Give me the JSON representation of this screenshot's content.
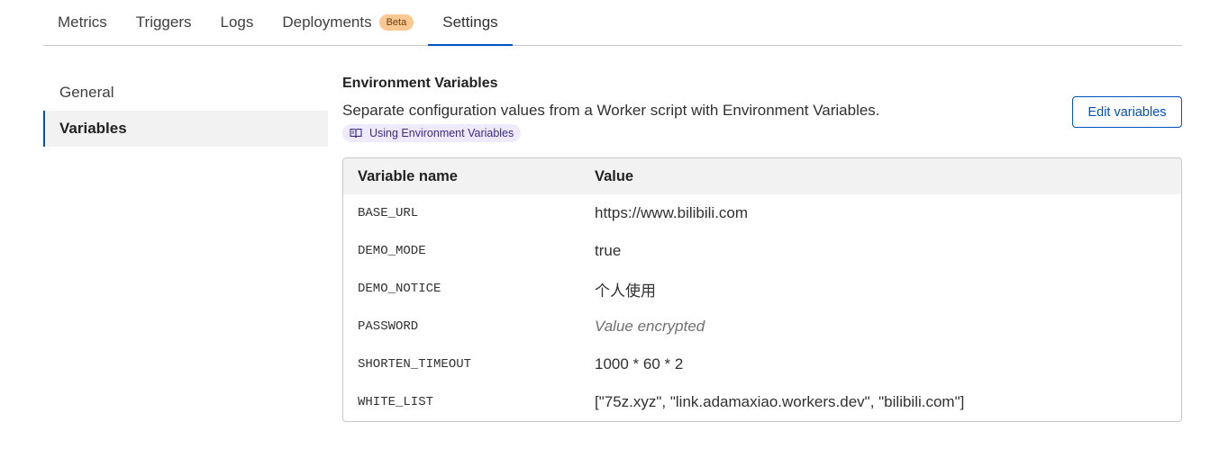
{
  "tabs": [
    {
      "label": "Metrics",
      "active": false
    },
    {
      "label": "Triggers",
      "active": false
    },
    {
      "label": "Logs",
      "active": false
    },
    {
      "label": "Deployments",
      "active": false,
      "badge": "Beta"
    },
    {
      "label": "Settings",
      "active": true
    }
  ],
  "sidebar": {
    "items": [
      {
        "label": "General",
        "active": false
      },
      {
        "label": "Variables",
        "active": true
      }
    ]
  },
  "env": {
    "title": "Environment Variables",
    "description": "Separate configuration values from a Worker script with Environment Variables.",
    "doc_link": "Using Environment Variables",
    "doc_icon": "book-icon",
    "edit_button": "Edit variables"
  },
  "table": {
    "headers": [
      "Variable name",
      "Value"
    ],
    "rows": [
      {
        "name": "BASE_URL",
        "value": "https://www.bilibili.com",
        "encrypted": false
      },
      {
        "name": "DEMO_MODE",
        "value": "true",
        "encrypted": false
      },
      {
        "name": "DEMO_NOTICE",
        "value": "个人使用",
        "encrypted": false
      },
      {
        "name": "PASSWORD",
        "value": "Value encrypted",
        "encrypted": true
      },
      {
        "name": "SHORTEN_TIMEOUT",
        "value": "1000 * 60 * 2",
        "encrypted": false
      },
      {
        "name": "WHITE_LIST",
        "value": "[\"75z.xyz\", \"link.adamaxiao.workers.dev\", \"bilibili.com\"]",
        "encrypted": false
      }
    ]
  },
  "colors": {
    "accent": "#0051c3",
    "badge_bg": "#fbc891",
    "doc_link_bg": "#efeafb"
  }
}
